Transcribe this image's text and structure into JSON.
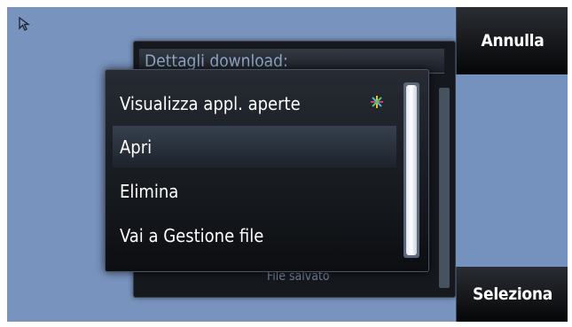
{
  "softkeys": {
    "top_label": "Annulla",
    "bottom_label": "Seleziona"
  },
  "background_dialog": {
    "title": "Dettagli download:",
    "partial_text": "File salvato"
  },
  "menu": {
    "items": [
      {
        "label": "Visualizza appl. aperte",
        "icon": "task-switch-icon"
      },
      {
        "label": "Apri",
        "selected": true
      },
      {
        "label": "Elimina"
      },
      {
        "label": "Vai a Gestione file"
      }
    ]
  },
  "colors": {
    "desktop": "#7893bd",
    "menu_bg": "#1a1e24",
    "text": "#ffffff"
  }
}
